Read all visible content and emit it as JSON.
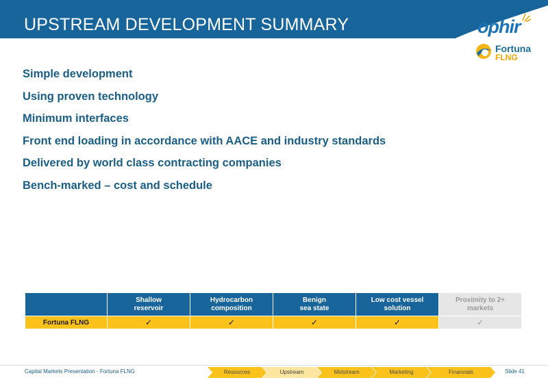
{
  "header": {
    "title": "UPSTREAM DEVELOPMENT SUMMARY"
  },
  "logos": {
    "ophir": "ophir",
    "fortuna_name": "Fortuna",
    "fortuna_sub": "FLNG"
  },
  "bullets": [
    "Simple development",
    "Using proven technology",
    "Minimum interfaces",
    "Front end loading in accordance with AACE and industry standards",
    "Delivered by world class contracting companies",
    "Bench-marked – cost and schedule"
  ],
  "table": {
    "columns": [
      [
        "Shallow",
        "reservoir"
      ],
      [
        "Hydrocarbon",
        "composition"
      ],
      [
        "Benign",
        "sea state"
      ],
      [
        "Low cost vessel",
        "solution"
      ],
      [
        "Proximity to 2+",
        "markets"
      ]
    ],
    "row_label": "Fortuna FLNG",
    "checks": [
      "✓",
      "✓",
      "✓",
      "✓",
      "✓"
    ]
  },
  "footer": {
    "left_text": "Capital Markets Presentation - Fortuna FLNG",
    "nav": [
      "Resources",
      "Upstream",
      "Midstream",
      "Marketing",
      "Financials"
    ],
    "active_index": 1,
    "slide": "Slide 41"
  },
  "colors": {
    "brand_blue": "#17659a",
    "accent_yellow": "#fbc21c"
  }
}
